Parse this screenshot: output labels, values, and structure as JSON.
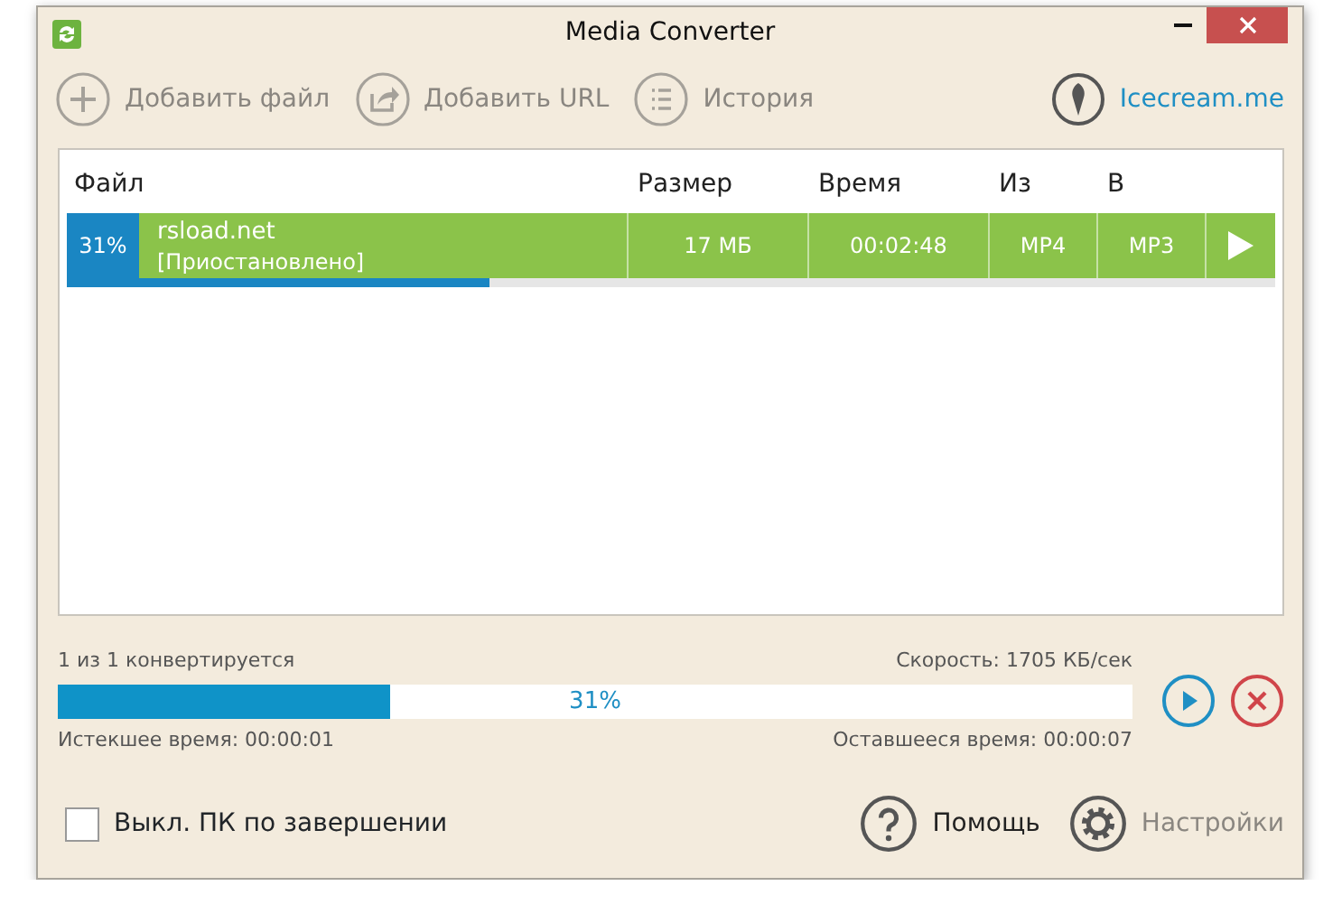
{
  "window": {
    "title": "Media Converter"
  },
  "toolbar": [
    {
      "kind": "add",
      "label": "Добавить файл"
    },
    {
      "kind": "share",
      "label": "Добавить URL"
    },
    {
      "kind": "list",
      "label": "История"
    }
  ],
  "brand_link": "Icecream.me",
  "table": {
    "columns": [
      "Файл",
      "Размер",
      "Время",
      "Из",
      "В"
    ],
    "rows": [
      {
        "percent": "31%",
        "name": "rsload.net",
        "status": "[Приостановлено]",
        "size": "17 МБ",
        "time": "00:02:48",
        "from": "MP4",
        "to": "MP3",
        "level": 0.35
      }
    ]
  },
  "progress": {
    "status": "1 из 1 конвертируется",
    "speed": "Скорость: 1705 КБ/сек",
    "level": 0.31,
    "percent": "31%",
    "elapsed": "Истекшее время: 00:00:01",
    "remaining": "Оставшееся время: 00:00:07"
  },
  "shutdown": {
    "label": "Выкл. ПК по завершении",
    "checked": false
  },
  "footer": [
    {
      "kind": "help",
      "label": "Помощь"
    },
    {
      "kind": "settings",
      "label": "Настройки"
    }
  ]
}
